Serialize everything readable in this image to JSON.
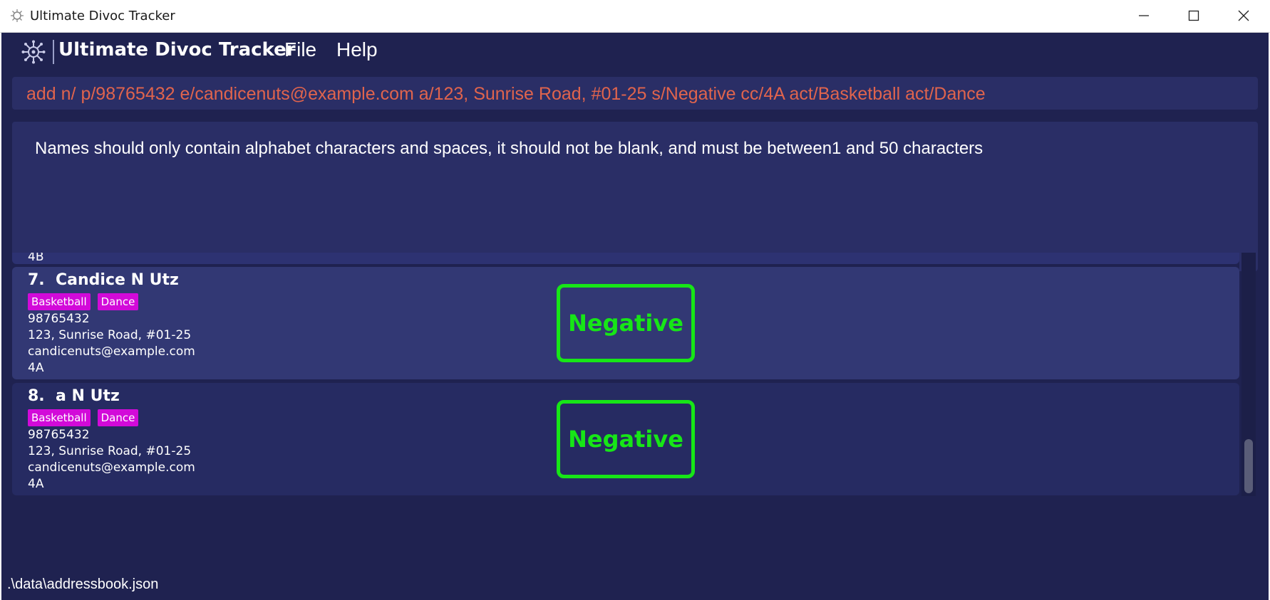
{
  "window": {
    "title": "Ultimate Divoc Tracker",
    "controls": [
      "minimize",
      "maximize",
      "close"
    ]
  },
  "menubar": {
    "brand": "Ultimate Divoc Tracker",
    "items": [
      {
        "label": "File"
      },
      {
        "label": "Help"
      }
    ]
  },
  "command_box": {
    "value": "add n/ p/98765432 e/candicenuts@example.com a/123, Sunrise Road, #01-25 s/Negative cc/4A act/Basketball act/Dance"
  },
  "result_box": {
    "message": "Names should only contain alphabet characters and spaces, it should not be blank, and must be between1 and 50 characters"
  },
  "person_list": {
    "partial_previous_text": "4B",
    "cards": [
      {
        "index": "7.",
        "name": "Candice N Utz",
        "tags": [
          "Basketball",
          "Dance"
        ],
        "phone": "98765432",
        "address": "123, Sunrise Road, #01-25",
        "email": "candicenuts@example.com",
        "class": "4A",
        "status": "Negative"
      },
      {
        "index": "8.",
        "name": "a N Utz",
        "tags": [
          "Basketball",
          "Dance"
        ],
        "phone": "98765432",
        "address": "123, Sunrise Road, #01-25",
        "email": "candicenuts@example.com",
        "class": "4A",
        "status": "Negative"
      }
    ]
  },
  "status_bar": {
    "path": ".\\data\\addressbook.json"
  },
  "colors": {
    "background": "#1f2250",
    "panel": "#2a2e66",
    "command_text": "#e0644d",
    "tag": "#d20ad9",
    "status_negative": "#17e617"
  },
  "icons": {
    "app": "virus-icon",
    "logo": "virus-icon"
  }
}
